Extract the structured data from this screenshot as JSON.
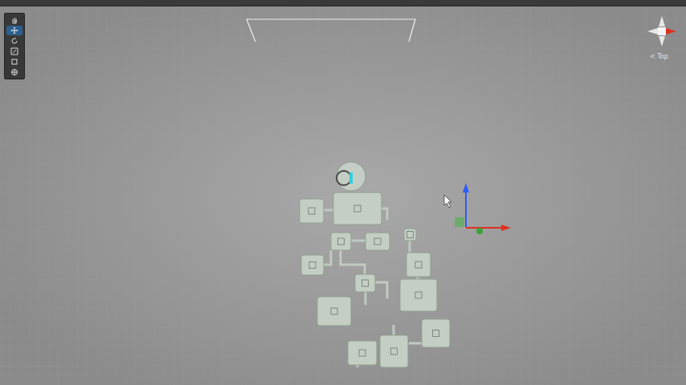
{
  "view": {
    "orientation_label": "< Top"
  },
  "tools": [
    {
      "kind": "hand",
      "selected": false
    },
    {
      "kind": "move",
      "selected": true
    },
    {
      "kind": "rotate",
      "selected": false
    },
    {
      "kind": "scale",
      "selected": false
    },
    {
      "kind": "rect",
      "selected": false
    },
    {
      "kind": "transform",
      "selected": false
    }
  ]
}
